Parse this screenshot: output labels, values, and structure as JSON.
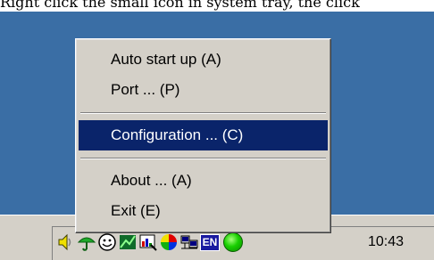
{
  "caption": "Right click the small icon in system tray, the click",
  "context_menu": {
    "items": [
      {
        "label": "Auto start up (A)"
      },
      {
        "label": "Port ... (P)"
      },
      {
        "label": "Configuration ... (C)",
        "selected": true
      },
      {
        "label": "About ... (A)"
      },
      {
        "label": "Exit (E)"
      }
    ]
  },
  "taskbar": {
    "tray_icons": [
      "speaker-icon",
      "umbrella-icon",
      "smiley-icon",
      "network-icon",
      "chart-icon",
      "colorwheel-icon",
      "computers-icon",
      "language-icon",
      "status-icon"
    ],
    "language_badge": "EN",
    "clock": "10:43"
  },
  "colors": {
    "desktop": "#3a6ea5",
    "face": "#d4d0c8",
    "selection": "#0a246a",
    "status_green": "#19d000"
  }
}
